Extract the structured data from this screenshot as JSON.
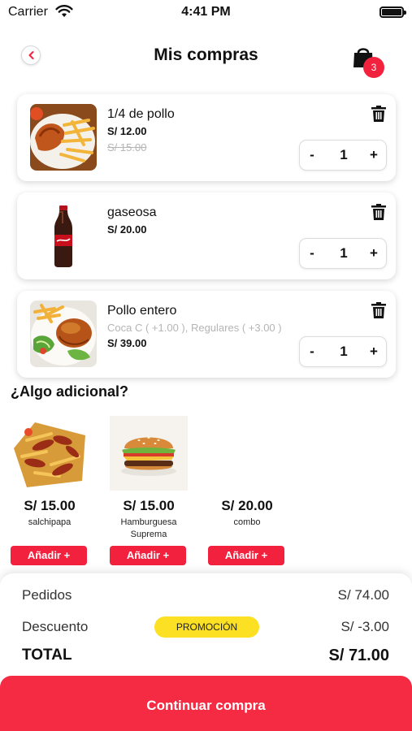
{
  "status_bar": {
    "carrier": "Carrier",
    "time": "4:41 PM"
  },
  "header": {
    "title": "Mis compras",
    "cart_count": "3"
  },
  "cart_items": [
    {
      "name": "1/4 de pollo",
      "options": "",
      "price": "S/ 12.00",
      "old_price": "S/ 15.00",
      "quantity": "1"
    },
    {
      "name": "gaseosa",
      "options": "",
      "price": "S/ 20.00",
      "old_price": "",
      "quantity": "1"
    },
    {
      "name": "Pollo entero",
      "options": "Coca C ( +1.00 ), Regulares ( +3.00 )",
      "price": "S/ 39.00",
      "old_price": "",
      "quantity": "1"
    }
  ],
  "stepper": {
    "minus": "-",
    "plus": "+"
  },
  "extras": {
    "title": "¿Algo adicional?",
    "add_label": "Añadir +",
    "items": [
      {
        "price": "S/ 15.00",
        "name": "salchipapa"
      },
      {
        "price": "S/ 15.00",
        "name": "Hamburguesa Suprema"
      },
      {
        "price": "S/ 20.00",
        "name": "combo"
      }
    ]
  },
  "summary": {
    "orders_label": "Pedidos",
    "orders_value": "S/ 74.00",
    "discount_label": "Descuento",
    "promo_badge": "PROMOCIÓN",
    "discount_value": "S/ -3.00",
    "total_label": "TOTAL",
    "total_value": "S/ 71.00"
  },
  "continue_button": "Continuar compra",
  "colors": {
    "accent": "#f2223f",
    "promo": "#fce024"
  },
  "icons": [
    "wifi-icon",
    "battery-icon",
    "back-chevron-icon",
    "shopping-bag-icon",
    "trash-icon"
  ]
}
